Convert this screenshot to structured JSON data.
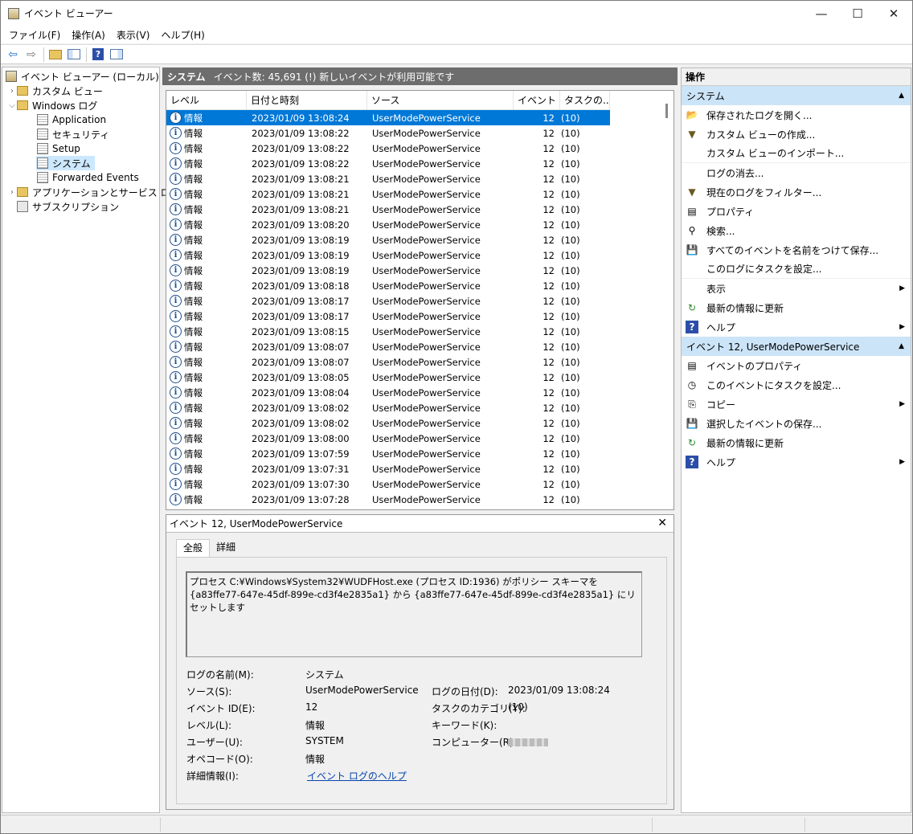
{
  "window": {
    "title": "イベント ビューアー"
  },
  "menu": [
    "ファイル(F)",
    "操作(A)",
    "表示(V)",
    "ヘルプ(H)"
  ],
  "tree": [
    {
      "label": "イベント ビューアー (ローカル)"
    },
    {
      "label": "カスタム ビュー"
    },
    {
      "label": "Windows ログ"
    },
    {
      "label": "Application"
    },
    {
      "label": "セキュリティ"
    },
    {
      "label": "Setup"
    },
    {
      "label": "システム"
    },
    {
      "label": "Forwarded Events"
    },
    {
      "label": "アプリケーションとサービス ログ"
    },
    {
      "label": "サブスクリプション"
    }
  ],
  "center": {
    "title": "システム",
    "count": "イベント数: 45,691 (!) 新しいイベントが利用可能です",
    "columns": [
      "レベル",
      "日付と時刻",
      "ソース",
      "イベント ...",
      "タスクの..."
    ],
    "rows": [
      [
        "情報",
        "2023/01/09 13:08:24",
        "UserModePowerService",
        "12",
        "(10)"
      ],
      [
        "情報",
        "2023/01/09 13:08:22",
        "UserModePowerService",
        "12",
        "(10)"
      ],
      [
        "情報",
        "2023/01/09 13:08:22",
        "UserModePowerService",
        "12",
        "(10)"
      ],
      [
        "情報",
        "2023/01/09 13:08:22",
        "UserModePowerService",
        "12",
        "(10)"
      ],
      [
        "情報",
        "2023/01/09 13:08:21",
        "UserModePowerService",
        "12",
        "(10)"
      ],
      [
        "情報",
        "2023/01/09 13:08:21",
        "UserModePowerService",
        "12",
        "(10)"
      ],
      [
        "情報",
        "2023/01/09 13:08:21",
        "UserModePowerService",
        "12",
        "(10)"
      ],
      [
        "情報",
        "2023/01/09 13:08:20",
        "UserModePowerService",
        "12",
        "(10)"
      ],
      [
        "情報",
        "2023/01/09 13:08:19",
        "UserModePowerService",
        "12",
        "(10)"
      ],
      [
        "情報",
        "2023/01/09 13:08:19",
        "UserModePowerService",
        "12",
        "(10)"
      ],
      [
        "情報",
        "2023/01/09 13:08:19",
        "UserModePowerService",
        "12",
        "(10)"
      ],
      [
        "情報",
        "2023/01/09 13:08:18",
        "UserModePowerService",
        "12",
        "(10)"
      ],
      [
        "情報",
        "2023/01/09 13:08:17",
        "UserModePowerService",
        "12",
        "(10)"
      ],
      [
        "情報",
        "2023/01/09 13:08:17",
        "UserModePowerService",
        "12",
        "(10)"
      ],
      [
        "情報",
        "2023/01/09 13:08:15",
        "UserModePowerService",
        "12",
        "(10)"
      ],
      [
        "情報",
        "2023/01/09 13:08:07",
        "UserModePowerService",
        "12",
        "(10)"
      ],
      [
        "情報",
        "2023/01/09 13:08:07",
        "UserModePowerService",
        "12",
        "(10)"
      ],
      [
        "情報",
        "2023/01/09 13:08:05",
        "UserModePowerService",
        "12",
        "(10)"
      ],
      [
        "情報",
        "2023/01/09 13:08:04",
        "UserModePowerService",
        "12",
        "(10)"
      ],
      [
        "情報",
        "2023/01/09 13:08:02",
        "UserModePowerService",
        "12",
        "(10)"
      ],
      [
        "情報",
        "2023/01/09 13:08:02",
        "UserModePowerService",
        "12",
        "(10)"
      ],
      [
        "情報",
        "2023/01/09 13:08:00",
        "UserModePowerService",
        "12",
        "(10)"
      ],
      [
        "情報",
        "2023/01/09 13:07:59",
        "UserModePowerService",
        "12",
        "(10)"
      ],
      [
        "情報",
        "2023/01/09 13:07:31",
        "UserModePowerService",
        "12",
        "(10)"
      ],
      [
        "情報",
        "2023/01/09 13:07:30",
        "UserModePowerService",
        "12",
        "(10)"
      ],
      [
        "情報",
        "2023/01/09 13:07:28",
        "UserModePowerService",
        "12",
        "(10)"
      ]
    ]
  },
  "detail": {
    "title": "イベント 12, UserModePowerService",
    "tabs": [
      "全般",
      "詳細"
    ],
    "description": "プロセス C:¥Windows¥System32¥WUDFHost.exe (プロセス ID:1936) がポリシー スキーマを {a83ffe77-647e-45df-899e-cd3f4e2835a1} から {a83ffe77-647e-45df-899e-cd3f4e2835a1} にリセットします",
    "labels": {
      "log_name": "ログの名前(M):",
      "source": "ソース(S):",
      "event_id": "イベント ID(E):",
      "level": "レベル(L):",
      "user": "ユーザー(U):",
      "opcode": "オペコード(O):",
      "more_info": "詳細情報(I):",
      "logged": "ログの日付(D):",
      "task_category": "タスクのカテゴリ(Y):",
      "keywords": "キーワード(K):",
      "computer": "コンピューター(R):"
    },
    "values": {
      "log_name": "システム",
      "source": "UserModePowerService",
      "event_id": "12",
      "level": "情報",
      "user": "SYSTEM",
      "opcode": "情報",
      "more_info": "イベント ログのヘルプ",
      "logged": "2023/01/09 13:08:24",
      "task_category": "(10)",
      "keywords": "",
      "computer": ""
    }
  },
  "actions": {
    "header": "操作",
    "section1": "システム",
    "items1": [
      "保存されたログを開く...",
      "カスタム ビューの作成...",
      "カスタム ビューのインポート...",
      "ログの消去...",
      "現在のログをフィルター...",
      "プロパティ",
      "検索...",
      "すべてのイベントを名前をつけて保存...",
      "このログにタスクを設定...",
      "表示",
      "最新の情報に更新",
      "ヘルプ"
    ],
    "section2": "イベント 12, UserModePowerService",
    "items2": [
      "イベントのプロパティ",
      "このイベントにタスクを設定...",
      "コピー",
      "選択したイベントの保存...",
      "最新の情報に更新",
      "ヘルプ"
    ]
  }
}
